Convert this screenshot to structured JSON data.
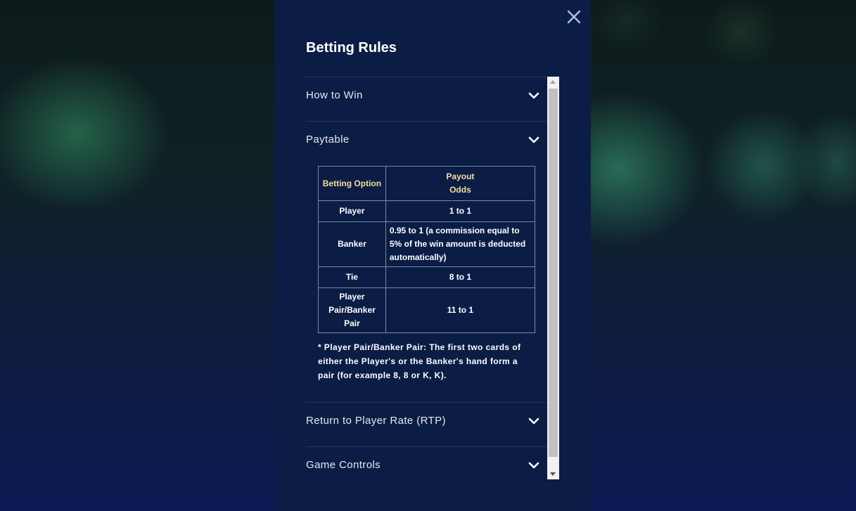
{
  "modal": {
    "title": "Betting Rules",
    "close_icon": "close-icon"
  },
  "sections": [
    {
      "label": "How to Win",
      "expanded": false
    },
    {
      "label": "Paytable",
      "expanded": true
    },
    {
      "label": "Return to Player Rate (RTP)",
      "expanded": false
    },
    {
      "label": "Game Controls",
      "expanded": false
    }
  ],
  "paytable": {
    "headers": {
      "option": "Betting Option",
      "odds_line1": "Payout",
      "odds_line2": "Odds"
    },
    "rows": [
      {
        "option": "Player",
        "odds": "1 to 1"
      },
      {
        "option": "Banker",
        "odds": "0.95 to 1 (a commission equal to 5% of the win amount is deducted automatically)"
      },
      {
        "option": "Tie",
        "odds": "8 to 1"
      },
      {
        "option": "Player Pair/Banker Pair",
        "odds": "11 to 1"
      }
    ],
    "note": "* Player Pair/Banker Pair: The first two cards of either the Player's or the Banker's hand form a pair (for example 8, 8 or K, K)."
  },
  "colors": {
    "panel_bg": "#0b1d45",
    "header_accent": "#f4dea0",
    "text": "#ffffff"
  }
}
